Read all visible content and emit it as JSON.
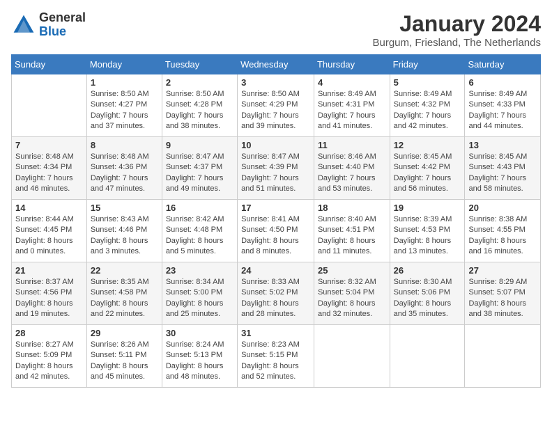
{
  "header": {
    "logo_general": "General",
    "logo_blue": "Blue",
    "month_year": "January 2024",
    "location": "Burgum, Friesland, The Netherlands"
  },
  "weekdays": [
    "Sunday",
    "Monday",
    "Tuesday",
    "Wednesday",
    "Thursday",
    "Friday",
    "Saturday"
  ],
  "weeks": [
    [
      {
        "day": "",
        "info": ""
      },
      {
        "day": "1",
        "info": "Sunrise: 8:50 AM\nSunset: 4:27 PM\nDaylight: 7 hours\nand 37 minutes."
      },
      {
        "day": "2",
        "info": "Sunrise: 8:50 AM\nSunset: 4:28 PM\nDaylight: 7 hours\nand 38 minutes."
      },
      {
        "day": "3",
        "info": "Sunrise: 8:50 AM\nSunset: 4:29 PM\nDaylight: 7 hours\nand 39 minutes."
      },
      {
        "day": "4",
        "info": "Sunrise: 8:49 AM\nSunset: 4:31 PM\nDaylight: 7 hours\nand 41 minutes."
      },
      {
        "day": "5",
        "info": "Sunrise: 8:49 AM\nSunset: 4:32 PM\nDaylight: 7 hours\nand 42 minutes."
      },
      {
        "day": "6",
        "info": "Sunrise: 8:49 AM\nSunset: 4:33 PM\nDaylight: 7 hours\nand 44 minutes."
      }
    ],
    [
      {
        "day": "7",
        "info": "Sunrise: 8:48 AM\nSunset: 4:34 PM\nDaylight: 7 hours\nand 46 minutes."
      },
      {
        "day": "8",
        "info": "Sunrise: 8:48 AM\nSunset: 4:36 PM\nDaylight: 7 hours\nand 47 minutes."
      },
      {
        "day": "9",
        "info": "Sunrise: 8:47 AM\nSunset: 4:37 PM\nDaylight: 7 hours\nand 49 minutes."
      },
      {
        "day": "10",
        "info": "Sunrise: 8:47 AM\nSunset: 4:39 PM\nDaylight: 7 hours\nand 51 minutes."
      },
      {
        "day": "11",
        "info": "Sunrise: 8:46 AM\nSunset: 4:40 PM\nDaylight: 7 hours\nand 53 minutes."
      },
      {
        "day": "12",
        "info": "Sunrise: 8:45 AM\nSunset: 4:42 PM\nDaylight: 7 hours\nand 56 minutes."
      },
      {
        "day": "13",
        "info": "Sunrise: 8:45 AM\nSunset: 4:43 PM\nDaylight: 7 hours\nand 58 minutes."
      }
    ],
    [
      {
        "day": "14",
        "info": "Sunrise: 8:44 AM\nSunset: 4:45 PM\nDaylight: 8 hours\nand 0 minutes."
      },
      {
        "day": "15",
        "info": "Sunrise: 8:43 AM\nSunset: 4:46 PM\nDaylight: 8 hours\nand 3 minutes."
      },
      {
        "day": "16",
        "info": "Sunrise: 8:42 AM\nSunset: 4:48 PM\nDaylight: 8 hours\nand 5 minutes."
      },
      {
        "day": "17",
        "info": "Sunrise: 8:41 AM\nSunset: 4:50 PM\nDaylight: 8 hours\nand 8 minutes."
      },
      {
        "day": "18",
        "info": "Sunrise: 8:40 AM\nSunset: 4:51 PM\nDaylight: 8 hours\nand 11 minutes."
      },
      {
        "day": "19",
        "info": "Sunrise: 8:39 AM\nSunset: 4:53 PM\nDaylight: 8 hours\nand 13 minutes."
      },
      {
        "day": "20",
        "info": "Sunrise: 8:38 AM\nSunset: 4:55 PM\nDaylight: 8 hours\nand 16 minutes."
      }
    ],
    [
      {
        "day": "21",
        "info": "Sunrise: 8:37 AM\nSunset: 4:56 PM\nDaylight: 8 hours\nand 19 minutes."
      },
      {
        "day": "22",
        "info": "Sunrise: 8:35 AM\nSunset: 4:58 PM\nDaylight: 8 hours\nand 22 minutes."
      },
      {
        "day": "23",
        "info": "Sunrise: 8:34 AM\nSunset: 5:00 PM\nDaylight: 8 hours\nand 25 minutes."
      },
      {
        "day": "24",
        "info": "Sunrise: 8:33 AM\nSunset: 5:02 PM\nDaylight: 8 hours\nand 28 minutes."
      },
      {
        "day": "25",
        "info": "Sunrise: 8:32 AM\nSunset: 5:04 PM\nDaylight: 8 hours\nand 32 minutes."
      },
      {
        "day": "26",
        "info": "Sunrise: 8:30 AM\nSunset: 5:06 PM\nDaylight: 8 hours\nand 35 minutes."
      },
      {
        "day": "27",
        "info": "Sunrise: 8:29 AM\nSunset: 5:07 PM\nDaylight: 8 hours\nand 38 minutes."
      }
    ],
    [
      {
        "day": "28",
        "info": "Sunrise: 8:27 AM\nSunset: 5:09 PM\nDaylight: 8 hours\nand 42 minutes."
      },
      {
        "day": "29",
        "info": "Sunrise: 8:26 AM\nSunset: 5:11 PM\nDaylight: 8 hours\nand 45 minutes."
      },
      {
        "day": "30",
        "info": "Sunrise: 8:24 AM\nSunset: 5:13 PM\nDaylight: 8 hours\nand 48 minutes."
      },
      {
        "day": "31",
        "info": "Sunrise: 8:23 AM\nSunset: 5:15 PM\nDaylight: 8 hours\nand 52 minutes."
      },
      {
        "day": "",
        "info": ""
      },
      {
        "day": "",
        "info": ""
      },
      {
        "day": "",
        "info": ""
      }
    ]
  ]
}
